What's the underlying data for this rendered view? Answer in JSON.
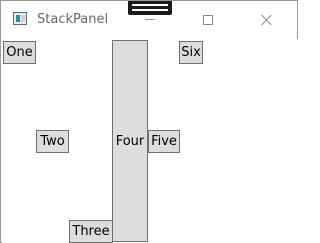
{
  "window": {
    "title": "StackPanel",
    "icon": "wpf-app-icon",
    "caption_buttons": [
      "minimize-icon",
      "maximize-icon",
      "close-icon"
    ]
  },
  "panel": {
    "buttons": {
      "one": "One",
      "two": "Two",
      "three": "Three",
      "four": "Four",
      "five": "Five",
      "six": "Six"
    }
  },
  "colors": {
    "button_bg": "#dddddd",
    "button_border": "#707070",
    "title_text": "#666666"
  }
}
